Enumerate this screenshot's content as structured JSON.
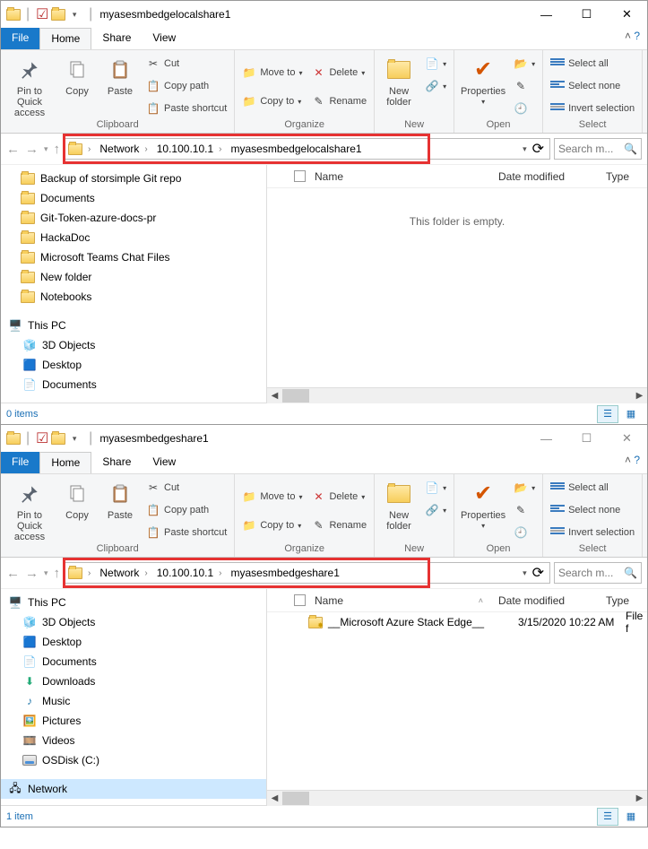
{
  "window1": {
    "title": "myasesmbedgelocalshare1",
    "tabs": {
      "file": "File",
      "home": "Home",
      "share": "Share",
      "view": "View"
    },
    "ribbon": {
      "pin": "Pin to Quick access",
      "copy": "Copy",
      "paste": "Paste",
      "cut": "Cut",
      "copypath": "Copy path",
      "pasteshortcut": "Paste shortcut",
      "moveto": "Move to",
      "copyto": "Copy to",
      "delete": "Delete",
      "rename": "Rename",
      "newfolder": "New folder",
      "properties": "Properties",
      "selectall": "Select all",
      "selectnone": "Select none",
      "invert": "Invert selection",
      "g_clipboard": "Clipboard",
      "g_organize": "Organize",
      "g_new": "New",
      "g_open": "Open",
      "g_select": "Select"
    },
    "breadcrumb": [
      "Network",
      "10.100.10.1",
      "myasesmbedgelocalshare1"
    ],
    "search_ph": "Search m...",
    "cols": {
      "name": "Name",
      "date": "Date modified",
      "type": "Type"
    },
    "empty": "This folder is empty.",
    "tree": {
      "qa_children": [
        "Backup of storsimple Git repo",
        "Documents",
        "Git-Token-azure-docs-pr",
        "HackaDoc",
        "Microsoft Teams Chat Files",
        "New folder",
        "Notebooks"
      ],
      "thispc": "This PC",
      "pc_children": [
        "3D Objects",
        "Desktop",
        "Documents"
      ]
    },
    "status": "0 items"
  },
  "window2": {
    "title": "myasesmbedgeshare1",
    "breadcrumb": [
      "Network",
      "10.100.10.1",
      "myasesmbedgeshare1"
    ],
    "search_ph": "Search m...",
    "tree": {
      "thispc": "This PC",
      "pc_children": [
        "3D Objects",
        "Desktop",
        "Documents",
        "Downloads",
        "Music",
        "Pictures",
        "Videos",
        "OSDisk (C:)"
      ],
      "network": "Network"
    },
    "file": {
      "name": "__Microsoft Azure Stack Edge__",
      "date": "3/15/2020 10:22 AM",
      "type": "File f"
    },
    "status": "1 item"
  }
}
